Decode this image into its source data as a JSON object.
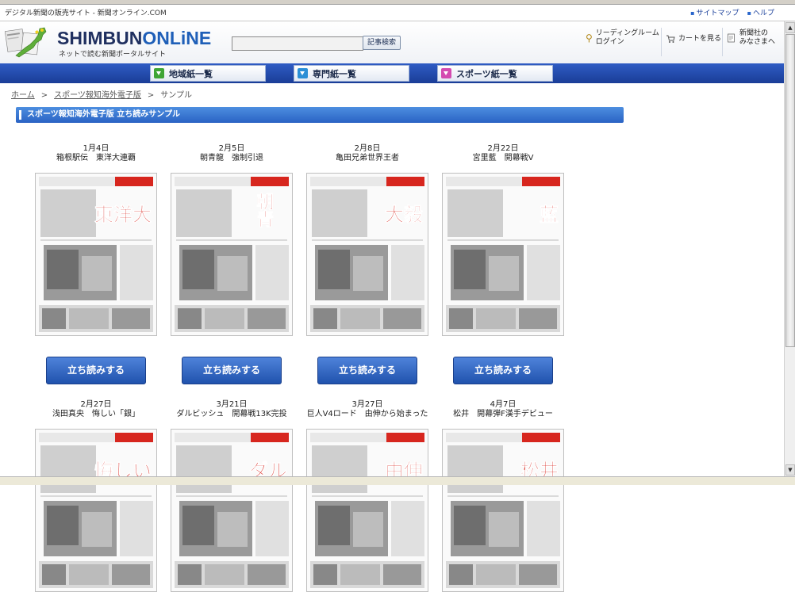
{
  "top_strip": {
    "description": "デジタル新聞の販売サイト - 新聞オンライン.COM",
    "links": [
      "サイトマップ",
      "ヘルプ"
    ]
  },
  "header": {
    "logo_main": "SHIMBUN",
    "logo_accent": "ONLiNE",
    "logo_sub": "ネットで読む新聞ポータルサイト",
    "search_placeholder": "",
    "search_button": "記事検索",
    "reading_room_line1": "リーディングルーム",
    "reading_room_line2": "ログイン",
    "cart": "カートを見る",
    "to_newspapers_line1": "新聞社の",
    "to_newspapers_line2": "みなさまへ"
  },
  "nav": {
    "tabs": [
      {
        "label": "地域紙一覧",
        "color": "#3fa535"
      },
      {
        "label": "専門紙一覧",
        "color": "#2b8fd6"
      },
      {
        "label": "スポーツ紙一覧",
        "color": "#d44bb0"
      }
    ]
  },
  "breadcrumb": {
    "home": "ホーム",
    "section": "スポーツ報知海外電子版",
    "current": "サンプル",
    "separator": ">"
  },
  "page_title": "スポーツ報知海外電子版 立ち読みサンプル",
  "read_button_label": "立ち読みする",
  "samples": [
    {
      "date": "1月4日",
      "caption": "箱根駅伝　東洋大連覇",
      "headline": "東洋大",
      "accent": "#d7261e"
    },
    {
      "date": "2月5日",
      "caption": "朝青龍　強制引退",
      "headline": "朝青",
      "accent": "#d7261e"
    },
    {
      "date": "2月8日",
      "caption": "亀田兄弟世界王者",
      "headline": "大毅",
      "accent": "#d7261e"
    },
    {
      "date": "2月22日",
      "caption": "宮里藍　開幕戦V",
      "headline": "藍",
      "accent": "#d7261e"
    },
    {
      "date": "2月27日",
      "caption": "浅田真央　悔しい「銀」",
      "headline": "悔しい",
      "accent": "#d7261e"
    },
    {
      "date": "3月21日",
      "caption": "ダルビッシュ　開幕戦13K完投",
      "headline": "ダル",
      "accent": "#d7261e"
    },
    {
      "date": "3月27日",
      "caption": "巨人V4ロード　由伸から始まった",
      "headline": "由伸",
      "accent": "#d7261e"
    },
    {
      "date": "4月7日",
      "caption": "松井　開幕弾F漢手デビュー",
      "headline": "松井",
      "accent": "#d7261e"
    }
  ]
}
